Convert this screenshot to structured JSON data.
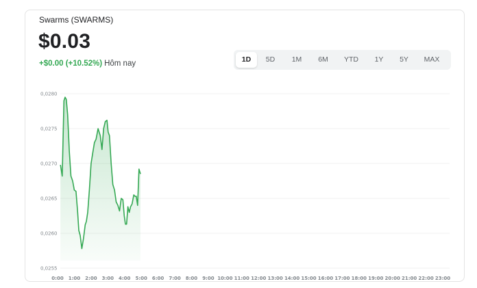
{
  "header": {
    "title": "Swarms (SWARMS)",
    "price": "$0.03",
    "change": "+$0.00 (+10.52%)",
    "change_label": "Hôm nay"
  },
  "tabs": [
    {
      "label": "1D",
      "active": true
    },
    {
      "label": "5D",
      "active": false
    },
    {
      "label": "1M",
      "active": false
    },
    {
      "label": "6M",
      "active": false
    },
    {
      "label": "YTD",
      "active": false
    },
    {
      "label": "1Y",
      "active": false
    },
    {
      "label": "5Y",
      "active": false
    },
    {
      "label": "MAX",
      "active": false
    }
  ],
  "colors": {
    "line": "#34a853",
    "grid": "#f1f1f1",
    "tab_bg": "#f1f3f4"
  },
  "chart_data": {
    "type": "area",
    "title": "",
    "xlabel": "",
    "ylabel": "",
    "ylim": [
      0.0255,
      0.0282
    ],
    "xlim": [
      0,
      23
    ],
    "y_ticks": [
      "0,0280",
      "0,0275",
      "0,0270",
      "0,0265",
      "0,0260",
      "0,0255"
    ],
    "y_tick_values": [
      0.028,
      0.0275,
      0.027,
      0.0265,
      0.026,
      0.0255
    ],
    "x_ticks": [
      "0:00",
      "1:00",
      "2:00",
      "3:00",
      "4:00",
      "5:00",
      "6:00",
      "7:00",
      "8:00",
      "9:00",
      "10:00",
      "11:00",
      "12:00",
      "13:00",
      "14:00",
      "15:00",
      "16:00",
      "17:00",
      "18:00",
      "19:00",
      "20:00",
      "21:00",
      "22:00",
      "23:00"
    ],
    "grid": true,
    "series": [
      {
        "x": [
          0.17,
          0.28,
          0.38,
          0.45,
          0.52,
          0.6,
          0.7,
          0.8,
          0.9,
          1.0,
          1.1,
          1.2,
          1.27,
          1.35,
          1.45,
          1.55,
          1.65,
          1.72,
          1.8,
          1.9,
          2.0,
          2.1,
          2.2,
          2.3,
          2.42,
          2.55,
          2.65,
          2.75,
          2.85,
          2.95,
          3.02,
          3.1,
          3.2,
          3.3,
          3.4,
          3.5,
          3.6,
          3.7,
          3.8,
          3.9,
          3.98,
          4.05,
          4.12,
          4.2,
          4.28,
          4.36,
          4.45,
          4.55,
          4.62,
          4.7,
          4.78,
          4.86,
          4.95
        ],
        "values": [
          0.02698,
          0.02682,
          0.0279,
          0.02795,
          0.02792,
          0.0277,
          0.02718,
          0.02682,
          0.02675,
          0.02662,
          0.0266,
          0.0263,
          0.02604,
          0.02597,
          0.02578,
          0.02593,
          0.02612,
          0.02617,
          0.0263,
          0.02662,
          0.027,
          0.02715,
          0.0273,
          0.02735,
          0.0275,
          0.0274,
          0.0272,
          0.0275,
          0.0276,
          0.02762,
          0.02745,
          0.0274,
          0.027,
          0.0267,
          0.02662,
          0.02645,
          0.0264,
          0.02632,
          0.0265,
          0.02648,
          0.02625,
          0.02613,
          0.02613,
          0.02638,
          0.0263,
          0.02638,
          0.02642,
          0.02655,
          0.02653,
          0.02653,
          0.0264,
          0.02692,
          0.02685
        ]
      }
    ]
  }
}
